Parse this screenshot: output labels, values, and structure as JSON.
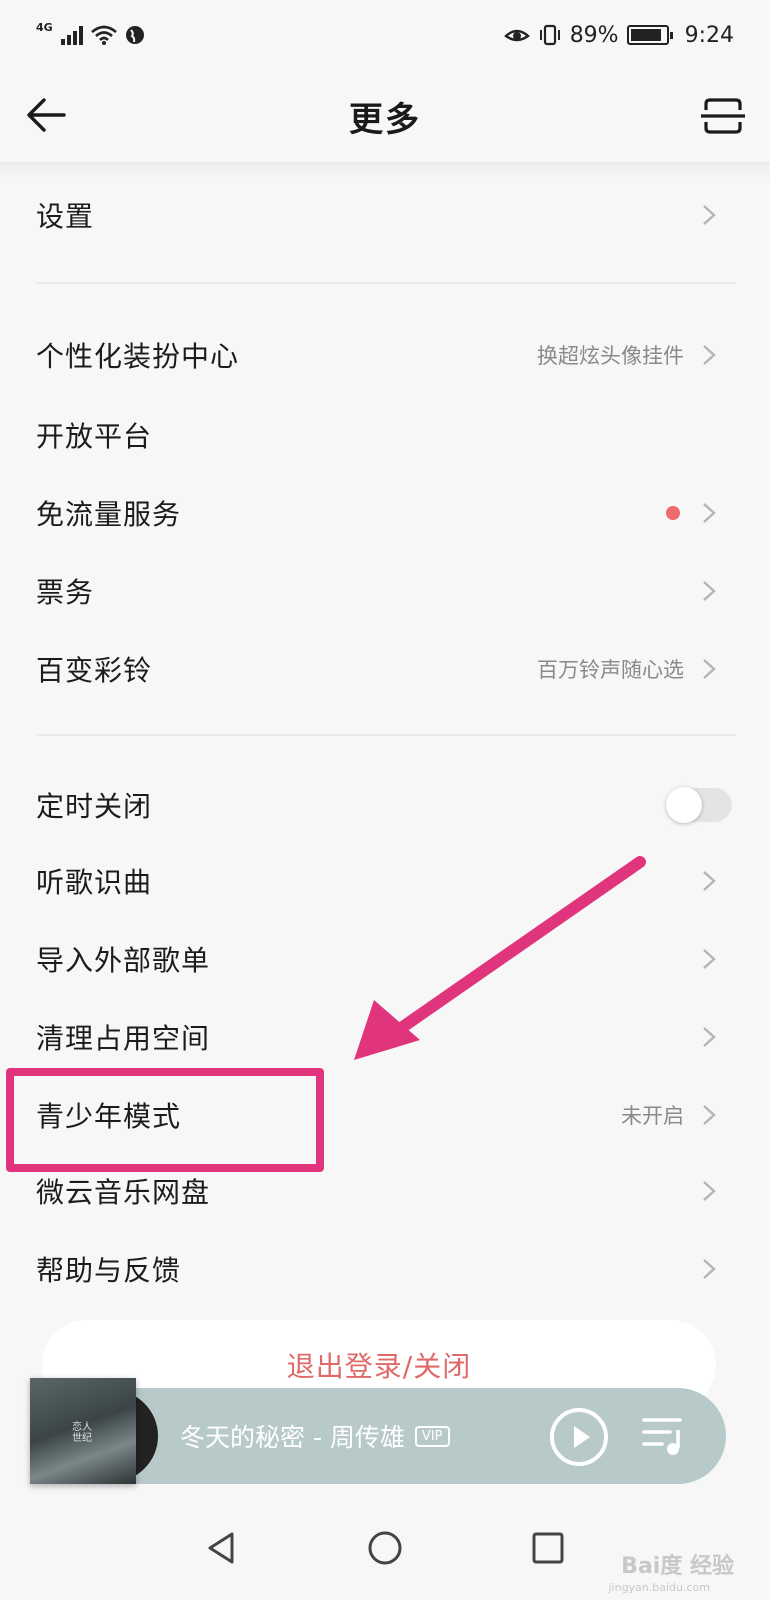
{
  "status_bar": {
    "network": "4G",
    "battery_percent": "89%",
    "battery_level": 0.89,
    "time": "9:24"
  },
  "header": {
    "title": "更多"
  },
  "menu": {
    "settings": {
      "label": "设置"
    },
    "personalize": {
      "label": "个性化装扮中心",
      "sub": "换超炫头像挂件"
    },
    "open_platform": {
      "label": "开放平台"
    },
    "free_data": {
      "label": "免流量服务"
    },
    "tickets": {
      "label": "票务"
    },
    "ringtone": {
      "label": "百变彩铃",
      "sub": "百万铃声随心选"
    },
    "sleep_timer": {
      "label": "定时关闭",
      "enabled": false
    },
    "song_recognition": {
      "label": "听歌识曲"
    },
    "import_playlist": {
      "label": "导入外部歌单"
    },
    "clean_storage": {
      "label": "清理占用空间"
    },
    "teen_mode": {
      "label": "青少年模式",
      "sub": "未开启"
    },
    "cloud_disk": {
      "label": "微云音乐网盘"
    },
    "help": {
      "label": "帮助与反馈"
    }
  },
  "logout": {
    "label": "退出登录/关闭"
  },
  "player": {
    "song": "冬天的秘密 - 周传雄",
    "badge": "VIP",
    "album_art_text": "恋人 世纪"
  },
  "watermark": {
    "brand": "Bai度 经验",
    "url": "jingyan.baidu.com"
  },
  "colors": {
    "highlight": "#e0357c",
    "accent_red": "#e06a6a",
    "player_bg": "#b8c9c9"
  }
}
